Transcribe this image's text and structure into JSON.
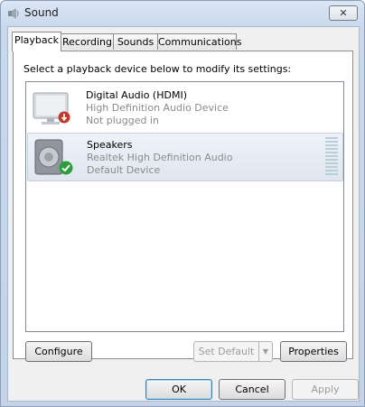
{
  "window": {
    "title": "Sound",
    "close_glyph": "✕"
  },
  "tabs": [
    {
      "label": "Playback",
      "active": true
    },
    {
      "label": "Recording",
      "active": false
    },
    {
      "label": "Sounds",
      "active": false
    },
    {
      "label": "Communications",
      "active": false
    }
  ],
  "playback": {
    "instruction": "Select a playback device below to modify its settings:",
    "devices": [
      {
        "name": "Digital Audio (HDMI)",
        "description": "High Definition Audio Device",
        "status": "Not plugged in",
        "icon": "monitor-icon",
        "badge": "unplugged-badge-icon",
        "selected": false
      },
      {
        "name": "Speakers",
        "description": "Realtek High Definition Audio",
        "status": "Default Device",
        "icon": "speaker-icon",
        "badge": "default-check-badge-icon",
        "selected": true
      }
    ],
    "buttons": {
      "configure": "Configure",
      "set_default": "Set Default",
      "properties": "Properties"
    }
  },
  "footer": {
    "ok": "OK",
    "cancel": "Cancel",
    "apply": "Apply"
  }
}
